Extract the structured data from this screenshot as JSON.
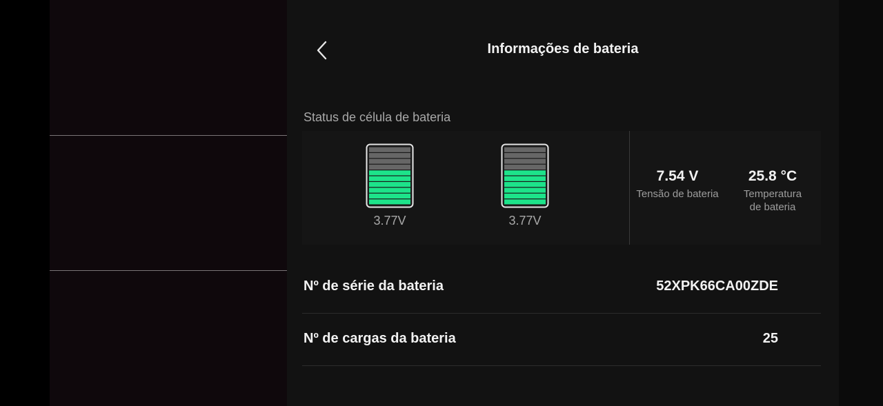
{
  "header": {
    "title": "Informações de bateria",
    "back_icon": "chevron-left-icon"
  },
  "cell_status": {
    "label": "Status de célula de bateria",
    "cells": [
      {
        "voltage": "3.77V",
        "charge_fraction": 0.6
      },
      {
        "voltage": "3.77V",
        "charge_fraction": 0.6
      }
    ],
    "battery_voltage": {
      "value": "7.54 V",
      "label": "Tensão de bateria"
    },
    "battery_temperature": {
      "value": "25.8 °C",
      "label_line1": "Temperatura",
      "label_line2": "de bateria"
    }
  },
  "info_rows": [
    {
      "label": "Nº de série da bateria",
      "value": "52XPK66CA00ZDE"
    },
    {
      "label": "Nº de cargas da bateria",
      "value": "25"
    }
  ],
  "colors": {
    "accent_green": "#1de38a",
    "empty_segment": "#666666",
    "panel_bg": "#121212"
  }
}
